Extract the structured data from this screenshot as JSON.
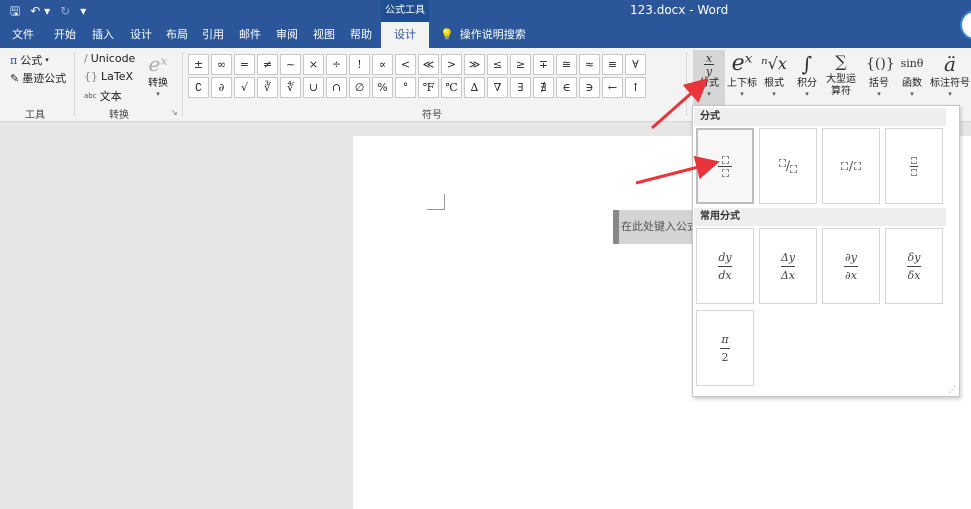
{
  "titlebar": {
    "contextual_tab": "公式工具",
    "document_title": "123.docx  -  Word",
    "qat": [
      "save-icon",
      "undo-icon",
      "redo-icon",
      "customize-icon"
    ]
  },
  "tabs": [
    {
      "label": "文件"
    },
    {
      "label": "开始"
    },
    {
      "label": "插入"
    },
    {
      "label": "设计"
    },
    {
      "label": "布局"
    },
    {
      "label": "引用"
    },
    {
      "label": "邮件"
    },
    {
      "label": "审阅"
    },
    {
      "label": "视图"
    },
    {
      "label": "帮助"
    },
    {
      "label": "设计",
      "active": true
    }
  ],
  "tell_me": "操作说明搜索",
  "ribbon": {
    "tools": {
      "equation": "公式",
      "ink_equation": "墨迹公式",
      "label": "工具"
    },
    "conversions": {
      "unicode": "Unicode",
      "latex": "LaTeX",
      "text": "文本",
      "convert": "转换",
      "label": "转换"
    },
    "symbols": {
      "label": "符号",
      "items": [
        "±",
        "∞",
        "=",
        "≠",
        "~",
        "×",
        "÷",
        "!",
        "∝",
        "<",
        "≪",
        ">",
        "≫",
        "≤",
        "≥",
        "∓",
        "≅",
        "≈",
        "≡",
        "∀",
        "∁",
        "∂",
        "√",
        "∛",
        "∜",
        "∪",
        "∩",
        "∅",
        "%",
        "°",
        "℉",
        "℃",
        "∆",
        "∇",
        "∃",
        "∄",
        "∈",
        "∋",
        "←",
        "↑"
      ]
    },
    "structures": [
      {
        "icon": "x/y",
        "label": "分式"
      },
      {
        "icon": "eˣ",
        "label": "上下标"
      },
      {
        "icon": "ⁿ√x",
        "label": "根式"
      },
      {
        "icon": "∫",
        "label": "积分"
      },
      {
        "icon": "∑",
        "label": "大型运算符"
      },
      {
        "icon": "{()}",
        "label": "括号"
      },
      {
        "icon": "sinθ",
        "label": "函数"
      },
      {
        "icon": "ä",
        "label": "标注符号"
      }
    ]
  },
  "document": {
    "equation_placeholder": "在此处键入公式"
  },
  "dropdown": {
    "section1_title": "分式",
    "section2_title": "常用分式",
    "common_fractions": [
      {
        "num": "dy",
        "den": "dx"
      },
      {
        "num": "Δy",
        "den": "Δx"
      },
      {
        "num": "∂y",
        "den": "∂x"
      },
      {
        "num": "δy",
        "den": "δx"
      },
      {
        "num": "π",
        "den": "2"
      }
    ]
  },
  "colors": {
    "title_bar": "#2b579a",
    "annotation_arrow": "#e8343a"
  }
}
